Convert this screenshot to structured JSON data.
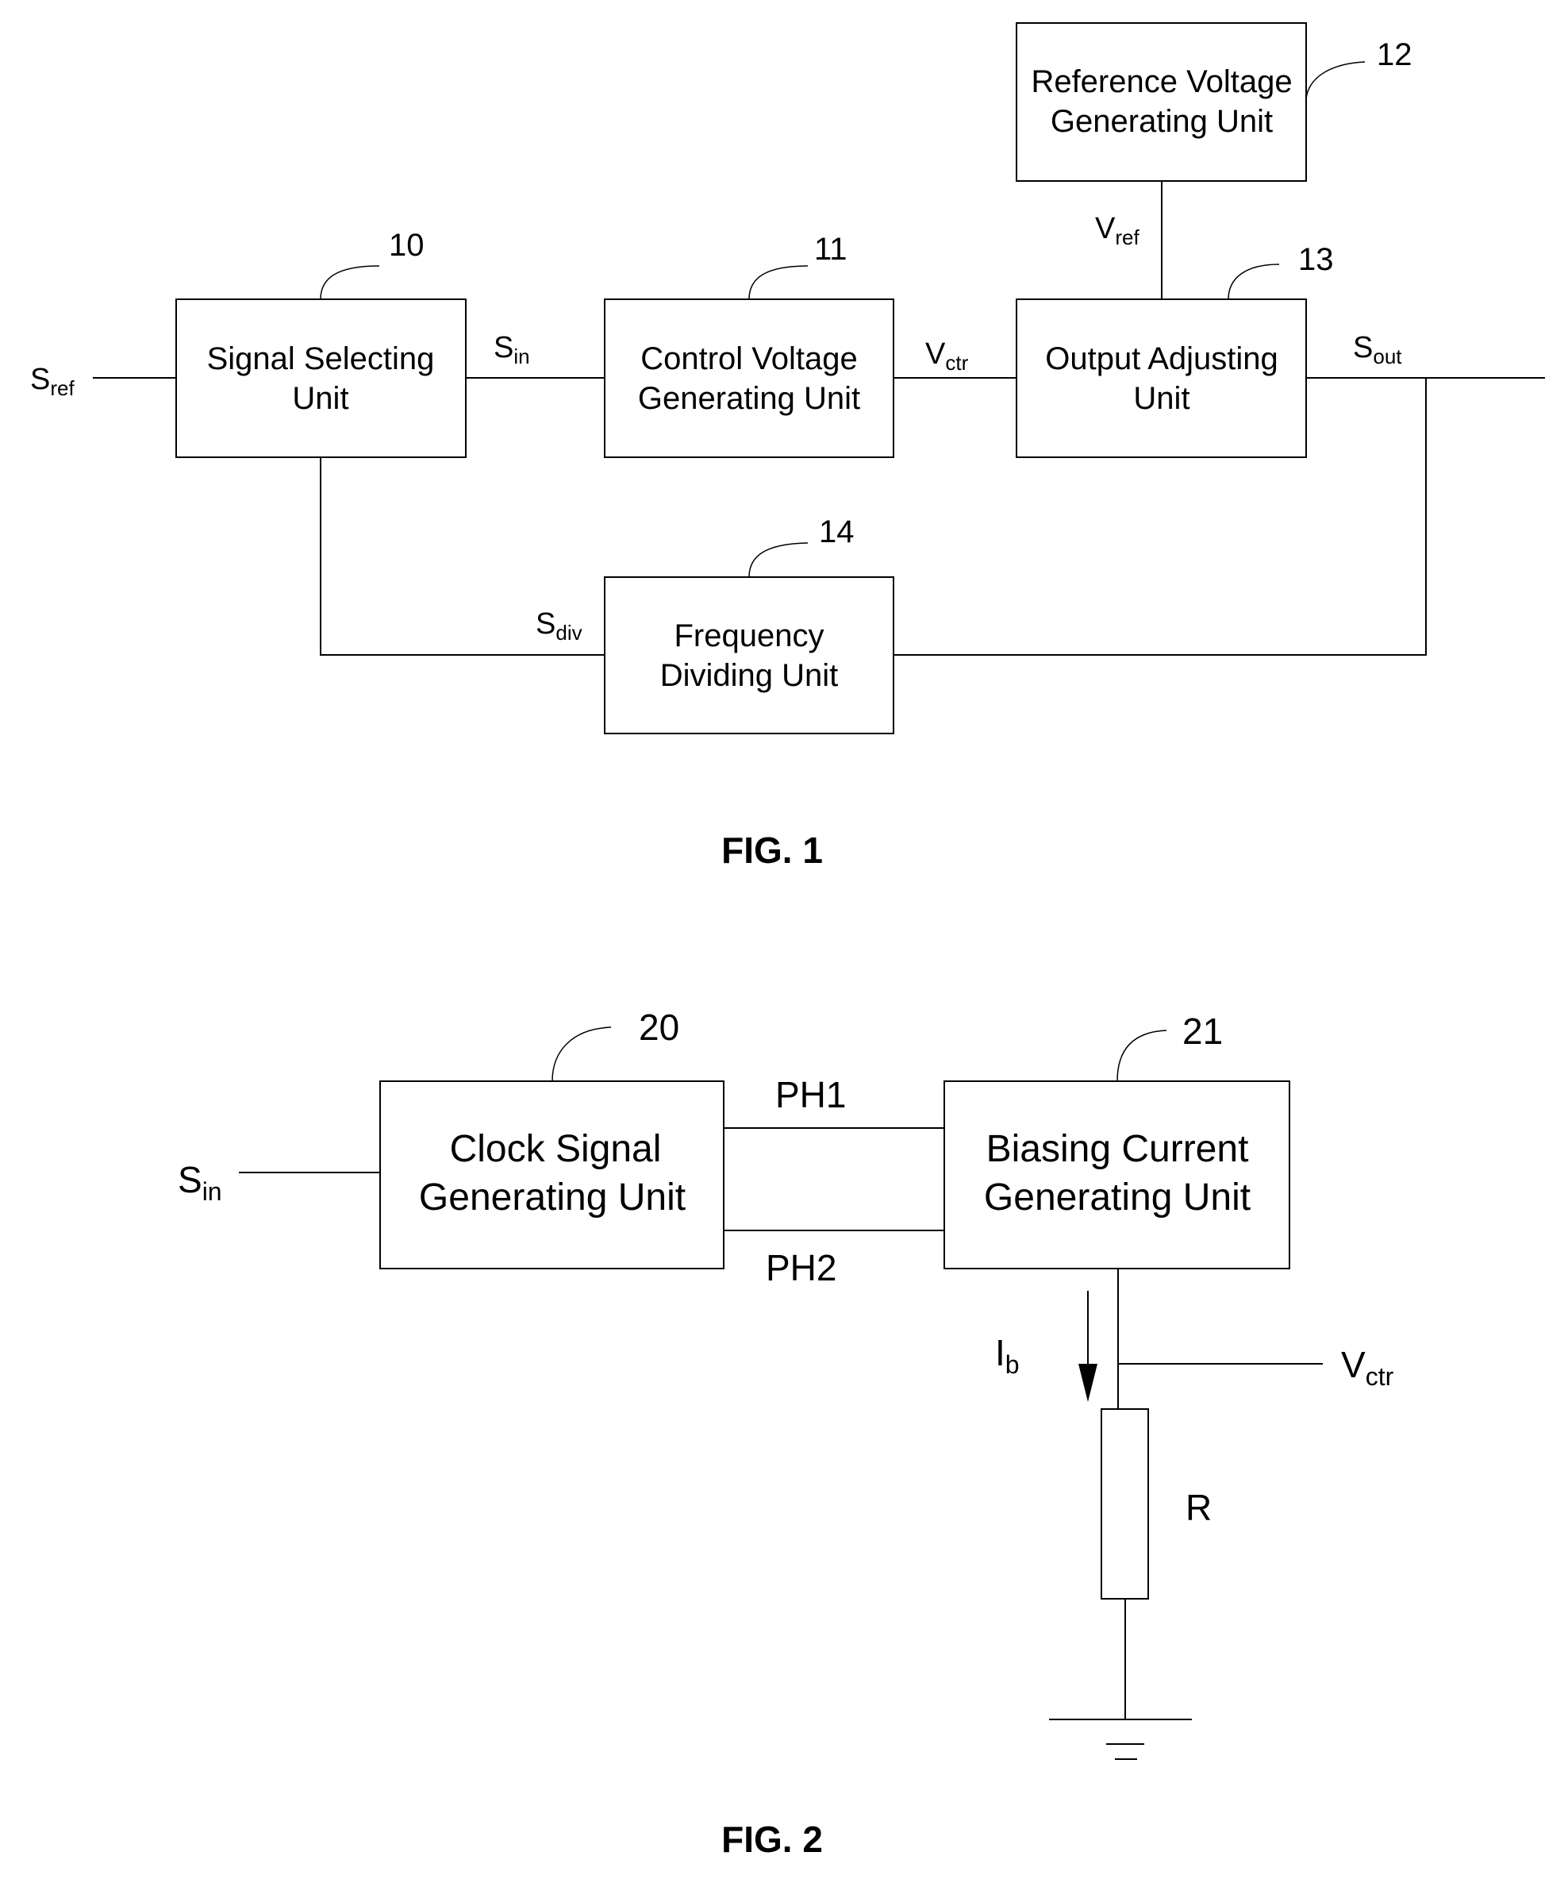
{
  "fig1": {
    "caption": "FIG. 1",
    "blocks": {
      "signal_selecting": {
        "ref": "10",
        "line1": "Signal Selecting",
        "line2": "Unit"
      },
      "control_voltage": {
        "ref": "11",
        "line1": "Control Voltage",
        "line2": "Generating Unit"
      },
      "reference_voltage": {
        "ref": "12",
        "line1": "Reference Voltage",
        "line2": "Generating Unit"
      },
      "output_adjusting": {
        "ref": "13",
        "line1": "Output Adjusting",
        "line2": "Unit"
      },
      "frequency_dividing": {
        "ref": "14",
        "line1": "Frequency",
        "line2": "Dividing Unit"
      }
    },
    "signals": {
      "sref": {
        "main": "S",
        "sub": "ref"
      },
      "sin": {
        "main": "S",
        "sub": "in"
      },
      "vctr": {
        "main": "V",
        "sub": "ctr"
      },
      "vref": {
        "main": "V",
        "sub": "ref"
      },
      "sout": {
        "main": "S",
        "sub": "out"
      },
      "sdiv": {
        "main": "S",
        "sub": "div"
      }
    }
  },
  "fig2": {
    "caption": "FIG. 2",
    "blocks": {
      "clock_signal": {
        "ref": "20",
        "line1": "Clock Signal",
        "line2": "Generating Unit"
      },
      "biasing_current": {
        "ref": "21",
        "line1": "Biasing Current",
        "line2": "Generating Unit"
      }
    },
    "signals": {
      "sin": {
        "main": "S",
        "sub": "in"
      },
      "ph1": "PH1",
      "ph2": "PH2",
      "ib": {
        "main": "I",
        "sub": "b"
      },
      "vctr": {
        "main": "V",
        "sub": "ctr"
      },
      "resistor": "R"
    }
  }
}
